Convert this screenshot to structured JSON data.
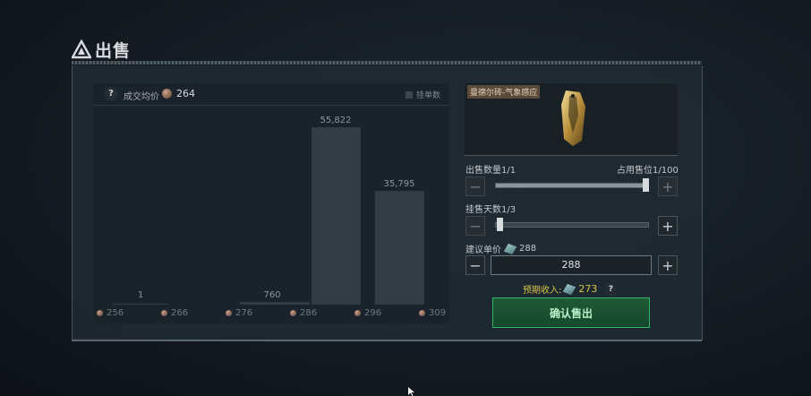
{
  "header": {
    "title": "出售"
  },
  "chart": {
    "avg_label": "成交均价",
    "avg_value": "264",
    "orders_toggle_label": "挂单数",
    "help_icon": "?"
  },
  "chart_data": {
    "type": "bar",
    "categories": [
      "256",
      "266",
      "276",
      "286",
      "296",
      "309"
    ],
    "value_labels": [
      "1",
      "760",
      "55,822",
      "35,795"
    ],
    "values": [
      1,
      760,
      55822,
      35795
    ],
    "bar_positions": [
      "256-266",
      "276-286",
      "286-296",
      "296-309"
    ]
  },
  "item": {
    "name": "曼德尔砖-气象感应"
  },
  "quantity": {
    "label": "出售数量1/1",
    "slots_label": "占用售位1/100",
    "value": 1
  },
  "days": {
    "label": "挂售天数1/3",
    "value": 0
  },
  "price": {
    "suggested_label": "建议单价",
    "suggested_value": "288",
    "input_value": "288"
  },
  "income": {
    "label": "预期收入:",
    "value": "273",
    "help_icon": "?"
  },
  "buttons": {
    "minus": "−",
    "plus": "+",
    "confirm": "确认售出"
  },
  "colors": {
    "accent_green": "#2fb568",
    "income_yellow": "#d7c64c"
  }
}
